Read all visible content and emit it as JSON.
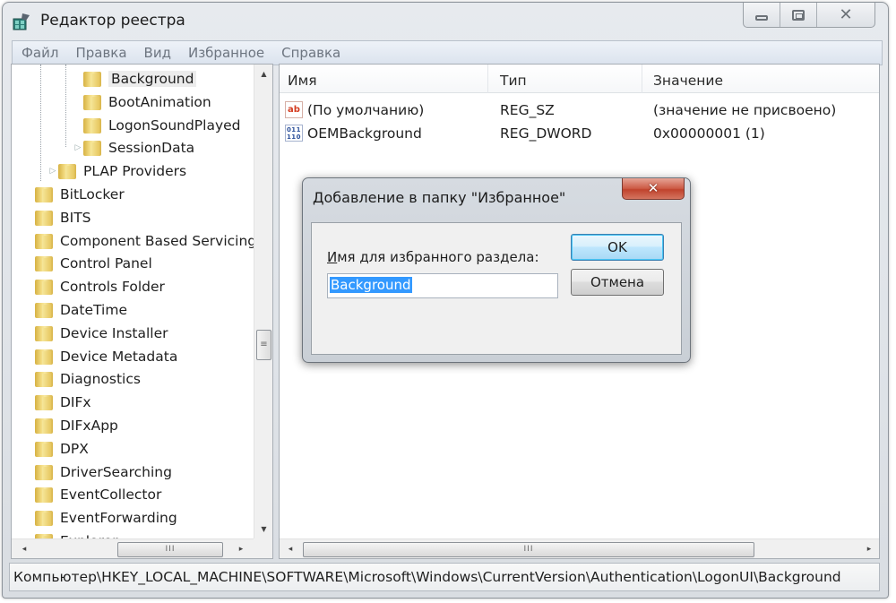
{
  "window": {
    "title": "Редактор реестра",
    "controls": {
      "minimize": "minimize",
      "maximize": "maximize",
      "close": "✕"
    }
  },
  "menubar": {
    "items": [
      "Файл",
      "Правка",
      "Вид",
      "Избранное",
      "Справка"
    ]
  },
  "tree": {
    "items": [
      {
        "label": "Background",
        "level": 2,
        "expander": "",
        "selected": true
      },
      {
        "label": "BootAnimation",
        "level": 2,
        "expander": ""
      },
      {
        "label": "LogonSoundPlayed",
        "level": 2,
        "expander": ""
      },
      {
        "label": "SessionData",
        "level": 2,
        "expander": "▷"
      },
      {
        "label": "PLAP Providers",
        "level": 1,
        "expander": "▷"
      },
      {
        "label": "BitLocker",
        "level": 0,
        "expander": ""
      },
      {
        "label": "BITS",
        "level": 0,
        "expander": ""
      },
      {
        "label": "Component Based Servicing",
        "level": 0,
        "expander": ""
      },
      {
        "label": "Control Panel",
        "level": 0,
        "expander": ""
      },
      {
        "label": "Controls Folder",
        "level": 0,
        "expander": ""
      },
      {
        "label": "DateTime",
        "level": 0,
        "expander": ""
      },
      {
        "label": "Device Installer",
        "level": 0,
        "expander": ""
      },
      {
        "label": "Device Metadata",
        "level": 0,
        "expander": ""
      },
      {
        "label": "Diagnostics",
        "level": 0,
        "expander": ""
      },
      {
        "label": "DIFx",
        "level": 0,
        "expander": ""
      },
      {
        "label": "DIFxApp",
        "level": 0,
        "expander": ""
      },
      {
        "label": "DPX",
        "level": 0,
        "expander": ""
      },
      {
        "label": "DriverSearching",
        "level": 0,
        "expander": ""
      },
      {
        "label": "EventCollector",
        "level": 0,
        "expander": ""
      },
      {
        "label": "EventForwarding",
        "level": 0,
        "expander": ""
      },
      {
        "label": "Explorer",
        "level": 0,
        "expander": ""
      }
    ],
    "scroll": {
      "up": "▲",
      "down": "▼",
      "left": "◂",
      "right": "▸",
      "grip": "≡",
      "hgrip": "III"
    }
  },
  "values": {
    "columns": [
      "Имя",
      "Тип",
      "Значение"
    ],
    "rows": [
      {
        "icon": "ab",
        "icon_name": "string-value-icon",
        "name": "(По умолчанию)",
        "type": "REG_SZ",
        "data": "(значение не присвоено)"
      },
      {
        "icon": "011 110",
        "icon_name": "binary-value-icon",
        "name": "OEMBackground",
        "type": "REG_DWORD",
        "data": "0x00000001 (1)"
      }
    ],
    "scroll": {
      "left": "◂",
      "right": "▸",
      "hgrip": "III"
    }
  },
  "statusbar": {
    "path": "Компьютер\\HKEY_LOCAL_MACHINE\\SOFTWARE\\Microsoft\\Windows\\CurrentVersion\\Authentication\\LogonUI\\Background"
  },
  "dialog": {
    "title": "Добавление в папку \"Избранное\"",
    "close": "✕",
    "label_accel": "И",
    "label_rest": "мя для избранного раздела:",
    "input_value": "Background",
    "ok_label": "OK",
    "cancel_label": "Отмена"
  },
  "colors": {
    "selection": "#3399ff",
    "ok_border": "#3c7fb1",
    "close_red": "#c0432d"
  }
}
